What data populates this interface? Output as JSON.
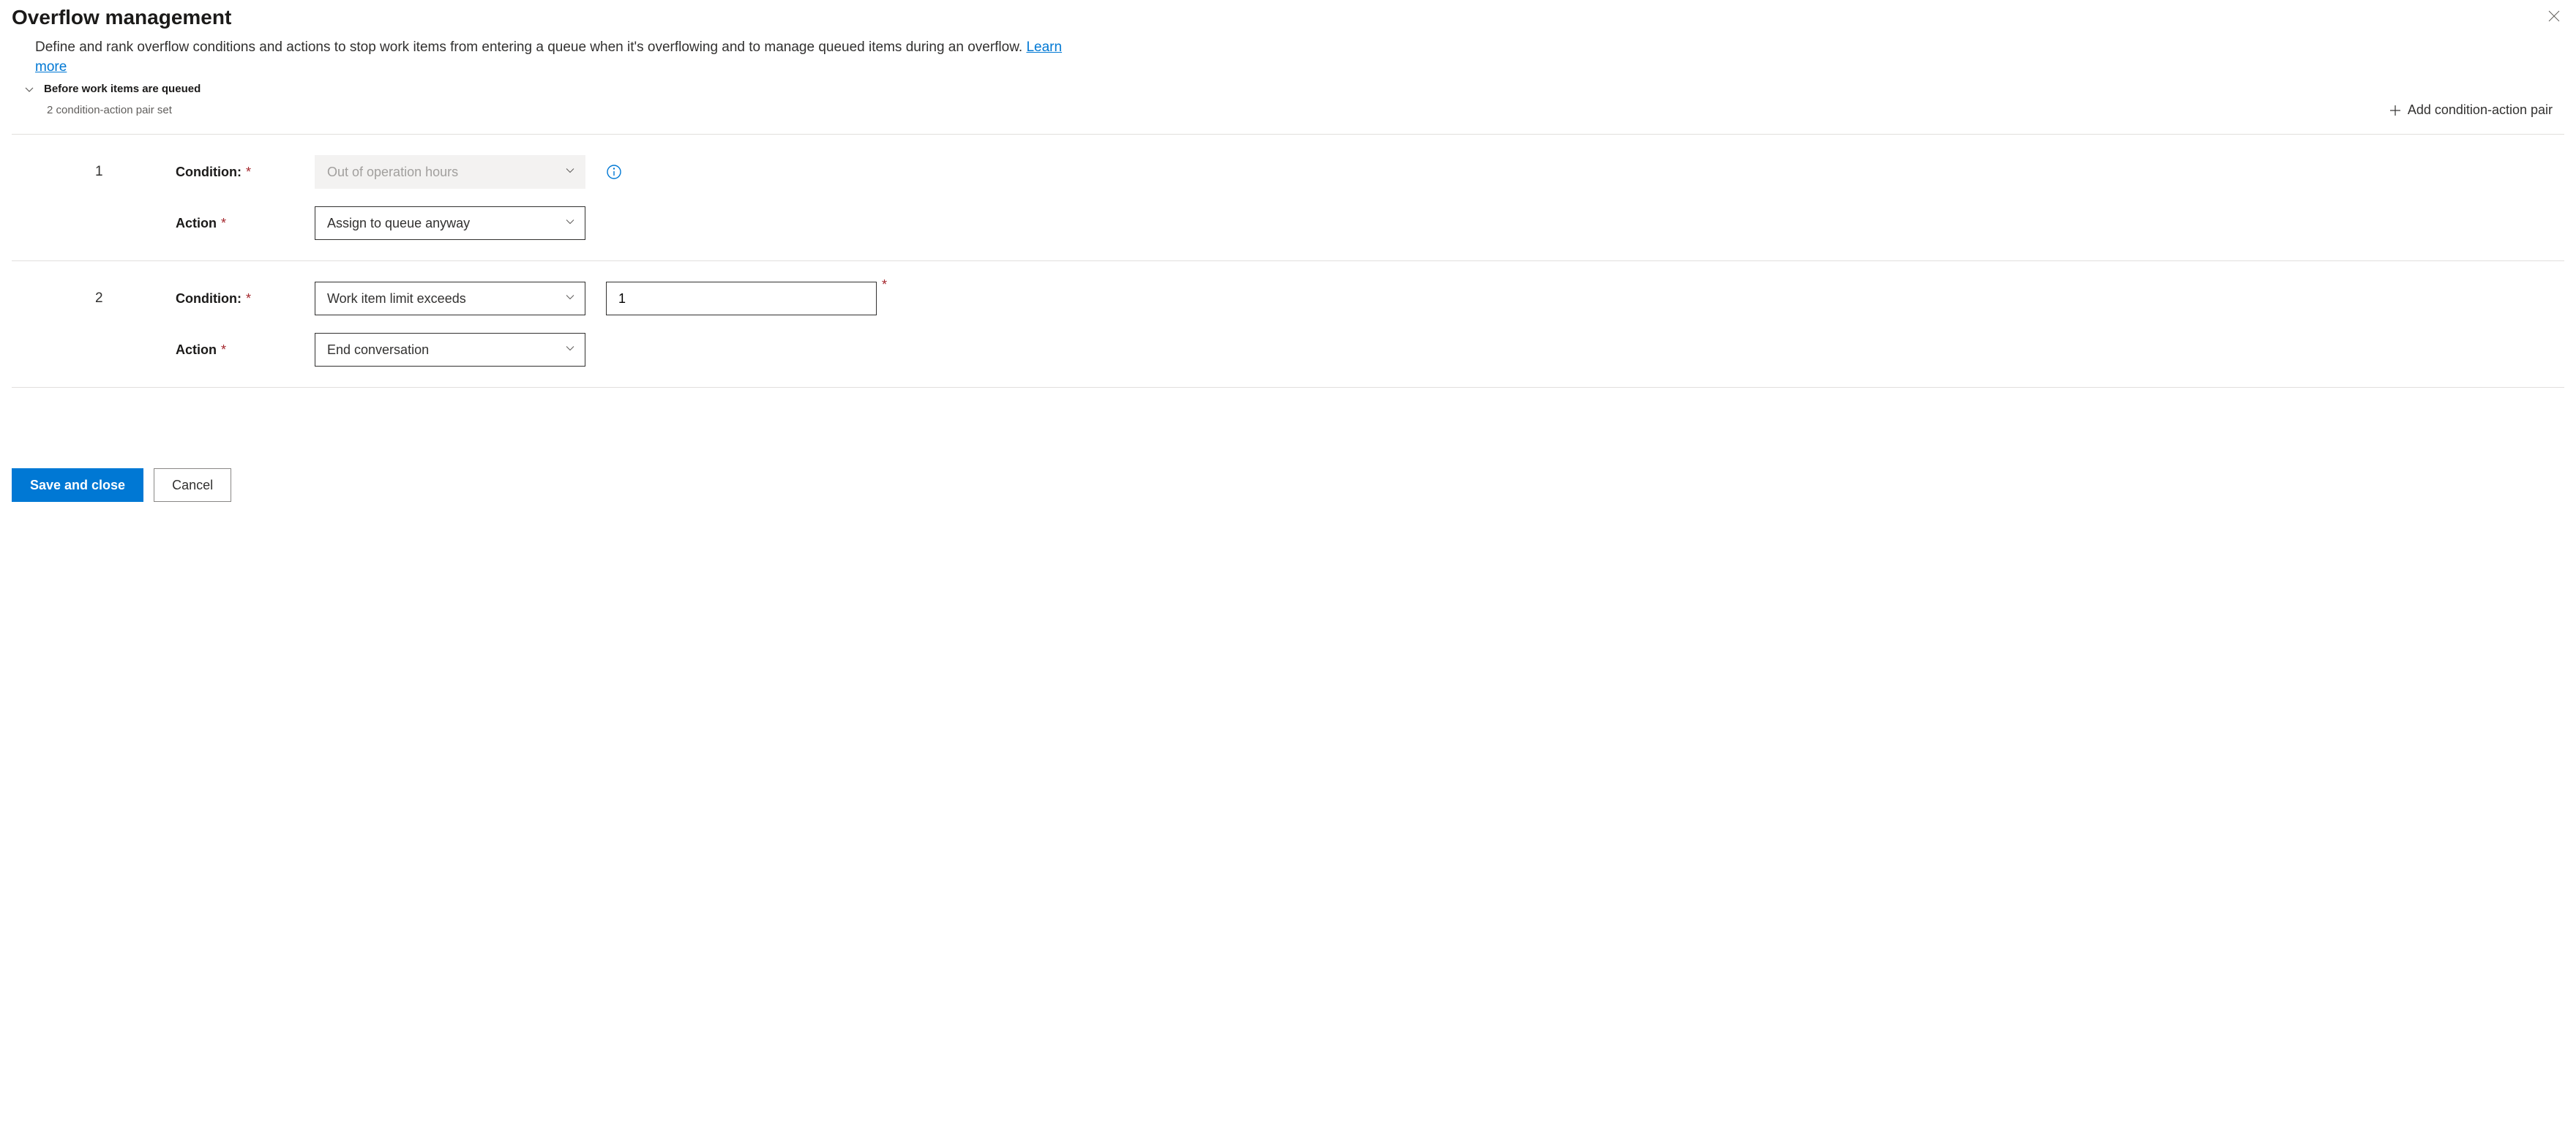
{
  "header": {
    "title": "Overflow management",
    "description": "Define and rank overflow conditions and actions to stop work items from entering a queue when it's overflowing and to manage queued items during an overflow. ",
    "learn_more": "Learn more"
  },
  "section": {
    "title": "Before work items are queued",
    "subtitle": "2 condition-action pair set",
    "add_button": "Add condition-action pair"
  },
  "labels": {
    "condition": "Condition:",
    "action": "Action"
  },
  "pairs": [
    {
      "index": "1",
      "condition_value": "Out of operation hours",
      "condition_disabled": true,
      "has_info": true,
      "action_value": "Assign to queue anyway",
      "extra_input": null
    },
    {
      "index": "2",
      "condition_value": "Work item limit exceeds",
      "condition_disabled": false,
      "has_info": false,
      "action_value": "End conversation",
      "extra_input": "1"
    }
  ],
  "footer": {
    "save": "Save and close",
    "cancel": "Cancel"
  }
}
